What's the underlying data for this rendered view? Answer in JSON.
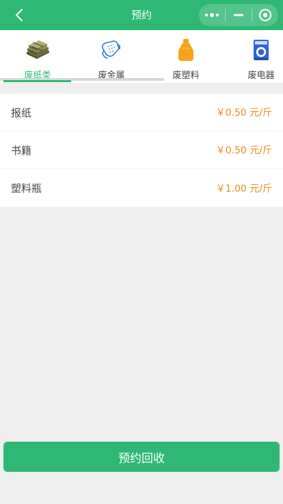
{
  "header": {
    "title": "预约",
    "background": "#2fb873",
    "back_icon": "chevron-left-icon",
    "capsule_more_icon": "more-dots-icon",
    "capsule_minimize_icon": "minimize-icon",
    "capsule_close_icon": "target-circle-icon"
  },
  "categories": [
    {
      "label": "废纸类",
      "icon": "paper-stack-icon",
      "active": true
    },
    {
      "label": "废金属",
      "icon": "metal-can-icon",
      "active": false
    },
    {
      "label": "废塑料",
      "icon": "plastic-bottle-icon",
      "active": false
    },
    {
      "label": "废电器",
      "icon": "washing-machine-icon",
      "active": false
    }
  ],
  "items": [
    {
      "name": "报纸",
      "price": "￥0.50 元/斤"
    },
    {
      "name": "书籍",
      "price": "￥0.50 元/斤"
    },
    {
      "name": "塑料瓶",
      "price": "￥1.00 元/斤"
    }
  ],
  "action": {
    "label": "预约回收"
  },
  "colors": {
    "accent": "#2fb873",
    "price": "#f08a19",
    "background": "#efefef"
  }
}
